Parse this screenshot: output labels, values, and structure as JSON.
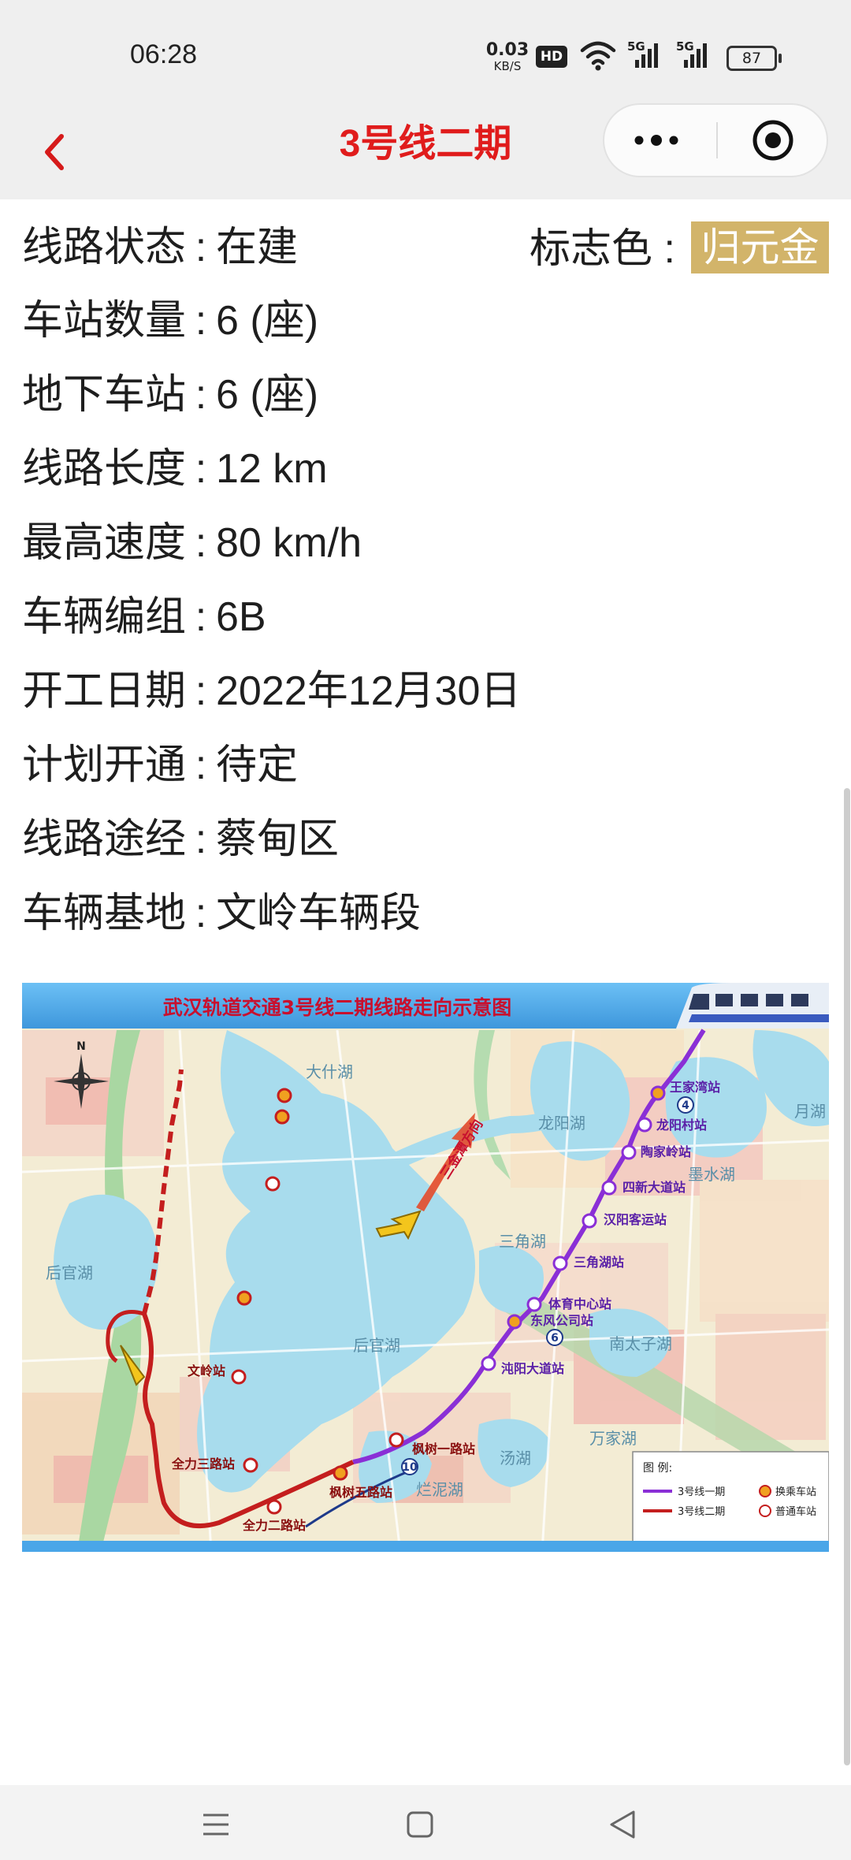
{
  "status_bar": {
    "time": "06:28",
    "net_speed": "0.03",
    "net_unit": "KB/S",
    "hd": "HD",
    "sig1": "5G",
    "sig2": "5G",
    "battery": "87"
  },
  "nav": {
    "title": "3号线二期",
    "back_icon": "chevron-left-icon",
    "more_icon": "more-dots-icon",
    "close_icon": "target-icon"
  },
  "info": {
    "sep": ":",
    "rows": [
      {
        "label": "线路状态",
        "value": "在建"
      },
      {
        "label": "车站数量",
        "value": "6 (座)"
      },
      {
        "label": "地下车站",
        "value": "6 (座)"
      },
      {
        "label": "线路长度",
        "value": "12 km"
      },
      {
        "label": "最高速度",
        "value": "80 km/h"
      },
      {
        "label": "车辆编组",
        "value": "6B"
      },
      {
        "label": "开工日期",
        "value": "2022年12月30日"
      },
      {
        "label": "计划开通",
        "value": "待定"
      },
      {
        "label": "线路途经",
        "value": "蔡甸区"
      },
      {
        "label": "车辆基地",
        "value": "文岭车辆段"
      }
    ],
    "flag_label": "标志色 :",
    "flag_value": "归元金",
    "flag_color": "#d2b46a"
  },
  "map": {
    "title": "武汉轨道交通3号线二期线路走向示意图",
    "compass": "N",
    "direction_label": "三金潭方向",
    "lakes": [
      "大什湖",
      "龙阳湖",
      "墨水湖",
      "月湖",
      "后官湖",
      "后官湖",
      "三角湖",
      "南太子湖",
      "万家湖",
      "汤湖",
      "烂泥湖"
    ],
    "phase1_stations": [
      "王家湾站",
      "龙阳村站",
      "陶家岭站",
      "四新大道站",
      "汉阳客运站",
      "三角湖站",
      "体育中心站",
      "东风公司站",
      "沌阳大道站"
    ],
    "phase2_stations": [
      "枫树一路站",
      "枫树五路站",
      "全力二路站",
      "全力三路站",
      "文岭站"
    ],
    "transfer_lines": [
      "4",
      "6",
      "10"
    ],
    "legend": {
      "title": "图 例:",
      "line1": "3号线一期",
      "line2": "3号线二期",
      "transfer": "换乘车站",
      "normal": "普通车站"
    },
    "colors": {
      "phase1": "#8a2fd6",
      "phase2": "#c41e1e",
      "header": "#4aa6e8",
      "title_text": "#c8102e"
    }
  },
  "bottom_nav": {
    "menu_icon": "menu-icon",
    "home_icon": "home-square-icon",
    "back_icon": "back-triangle-icon"
  }
}
